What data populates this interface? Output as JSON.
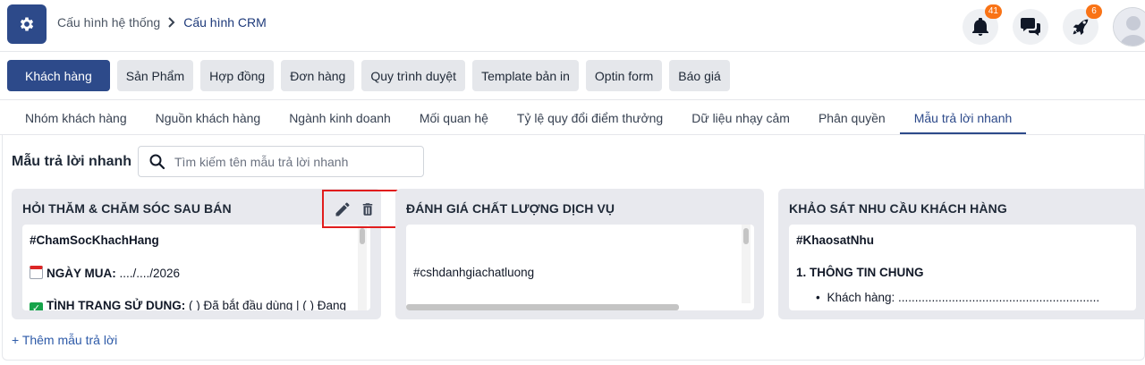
{
  "header": {
    "breadcrumb_parent": "Cấu hình hệ thống",
    "breadcrumb_current": "Cấu hình CRM",
    "notifications_count": "41",
    "rocket_count": "6"
  },
  "module_tabs": [
    "Khách hàng",
    "Sản Phẩm",
    "Hợp đồng",
    "Đơn hàng",
    "Quy trình duyệt",
    "Template bản in",
    "Optin form",
    "Báo giá"
  ],
  "sub_tabs": [
    "Nhóm khách hàng",
    "Nguồn khách hàng",
    "Ngành kinh doanh",
    "Mối quan hệ",
    "Tỷ lệ quy đổi điểm thưởng",
    "Dữ liệu nhạy cảm",
    "Phân quyền",
    "Mẫu trả lời nhanh"
  ],
  "main": {
    "title": "Mẫu trả lời nhanh",
    "search_placeholder": "Tìm kiếm tên mẫu trả lời nhanh",
    "add_label": "+ Thêm mẫu trả lời"
  },
  "cards": [
    {
      "title": "HỎI THĂM & CHĂM SÓC SAU BÁN",
      "line1": "#ChamSocKhachHang",
      "line2_label": "NGÀY MUA:",
      "line2_value": " ..../..../2026",
      "line3_label": "TÌNH TRẠNG SỬ DỤNG:",
      "line3_value": " ( ) Đã bắt đầu dùng | ( ) Đang"
    },
    {
      "title": "ĐÁNH GIÁ CHẤT LƯỢNG DỊCH VỤ",
      "line1": "#cshdanhgiachatluong"
    },
    {
      "title": "KHẢO SÁT NHU CẦU KHÁCH HÀNG",
      "line1": "#KhaosatNhu",
      "line2": "1. THÔNG TIN CHUNG",
      "line3": "Khách hàng: ............................................................"
    }
  ],
  "colors": {
    "primary": "#2d4a8a",
    "badge": "#f97316",
    "highlight_box": "#e11d1d",
    "link": "#2d5aa8"
  }
}
